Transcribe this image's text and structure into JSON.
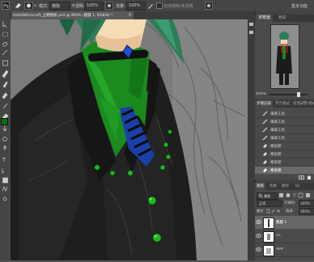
{
  "options_bar": {
    "mode_label": "模式:",
    "mode_value": "擦除",
    "opacity_label": "不透明:",
    "opacity_value": "100%",
    "flow_label": "流量:",
    "flow_value": "100%",
    "auto_erase_label": "自动抹除/未选择",
    "extra_label": "基本功能"
  },
  "document": {
    "tab_title": "HalloWitchcraft_立體模板.psd @ 400% (圖層 1, RGB/8) *"
  },
  "navigator": {
    "tabs": [
      "導覽器",
      "色彩"
    ],
    "zoom": "400%"
  },
  "history": {
    "tabs": [
      "步驟記錄",
      "字元樣式",
      "段落",
      "調整",
      "樣式"
    ],
    "items": [
      {
        "label": "筆刷工具",
        "icon": "brush-icon"
      },
      {
        "label": "筆刷工具",
        "icon": "brush-icon"
      },
      {
        "label": "筆刷工具",
        "icon": "brush-icon"
      },
      {
        "label": "筆刷工具",
        "icon": "brush-icon"
      },
      {
        "label": "橡皮擦",
        "icon": "eraser-icon"
      },
      {
        "label": "橡皮擦",
        "icon": "eraser-icon"
      },
      {
        "label": "橡皮擦",
        "icon": "eraser-icon"
      },
      {
        "label": "橡皮擦",
        "icon": "eraser-icon"
      }
    ]
  },
  "layers": {
    "tabs": [
      "圖層",
      "色版",
      "路徑",
      "3D"
    ],
    "filter_kind": "種類",
    "blend_mode": "正常",
    "opacity_label": "不透明:",
    "opacity_value": "100%",
    "lock_label": "鎖定:",
    "fill_label": "填滿:",
    "fill_value": "100%",
    "items": [
      {
        "name": "圖層 1"
      },
      {
        "name": "55"
      },
      {
        "name": "999"
      }
    ]
  },
  "colors": {
    "accent": "#e8541e",
    "canvas_bg": "#7a7a7a",
    "suit": "#1c1c1c",
    "shirt_green": "#1b8a1f",
    "tie_blue": "#1d49c8",
    "hair_green": "#2c7d59"
  }
}
